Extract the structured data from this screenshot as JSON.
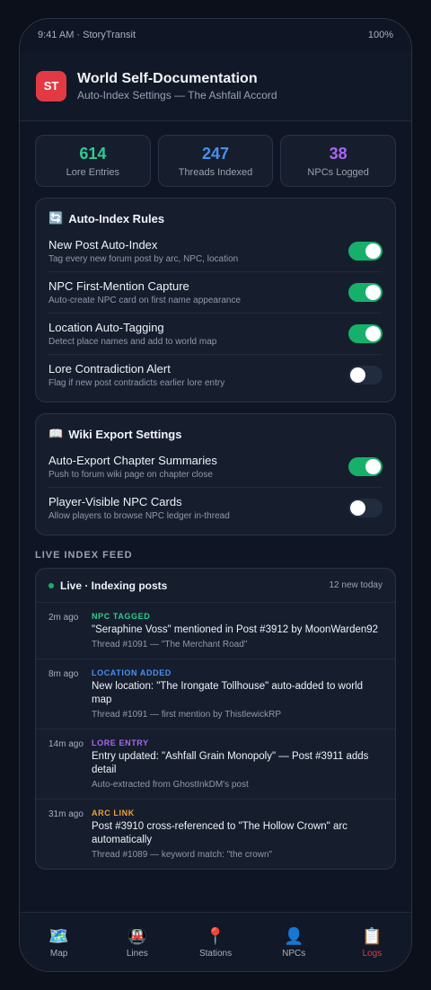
{
  "status_bar": {
    "left": "9:41 AM · StoryTransit",
    "right": "100%"
  },
  "header": {
    "logo": "ST",
    "title": "World Self-Documentation",
    "subtitle": "Auto-Index Settings — The Ashfall Accord"
  },
  "stats": [
    {
      "value": "614",
      "label": "Lore Entries",
      "color": "#2ecc8f"
    },
    {
      "value": "247",
      "label": "Threads Indexed",
      "color": "#4a8ff0"
    },
    {
      "value": "38",
      "label": "NPCs Logged",
      "color": "#a866f0"
    }
  ],
  "auto_index": {
    "icon": "🔄",
    "title": "Auto-Index Rules",
    "rows": [
      {
        "title": "New Post Auto-Index",
        "desc": "Tag every new forum post by arc, NPC, location",
        "on": true
      },
      {
        "title": "NPC First-Mention Capture",
        "desc": "Auto-create NPC card on first name appearance",
        "on": true
      },
      {
        "title": "Location Auto-Tagging",
        "desc": "Detect place names and add to world map",
        "on": true
      },
      {
        "title": "Lore Contradiction Alert",
        "desc": "Flag if new post contradicts earlier lore entry",
        "on": false
      }
    ]
  },
  "wiki_export": {
    "icon": "📖",
    "title": "Wiki Export Settings",
    "rows": [
      {
        "title": "Auto-Export Chapter Summaries",
        "desc": "Push to forum wiki page on chapter close",
        "on": true
      },
      {
        "title": "Player-Visible NPC Cards",
        "desc": "Allow players to browse NPC ledger in-thread",
        "on": false
      }
    ]
  },
  "feed": {
    "section_label": "LIVE INDEX FEED",
    "live_label": "Live · Indexing posts",
    "count": "12 new today",
    "entries": [
      {
        "time": "2m ago",
        "tag": "NPC TAGGED",
        "tag_color": "#2ecc8f",
        "message": "\"Seraphine Voss\" mentioned in Post #3912 by MoonWarden92",
        "meta": "Thread #1091 — \"The Merchant Road\""
      },
      {
        "time": "8m ago",
        "tag": "LOCATION ADDED",
        "tag_color": "#4a8ff0",
        "message": "New location: \"The Irongate Tollhouse\" auto-added to world map",
        "meta": "Thread #1091 — first mention by ThistlewickRP"
      },
      {
        "time": "14m ago",
        "tag": "LORE ENTRY",
        "tag_color": "#a866f0",
        "message": "Entry updated: \"Ashfall Grain Monopoly\" — Post #3911 adds detail",
        "meta": "Auto-extracted from GhostInkDM's post"
      },
      {
        "time": "31m ago",
        "tag": "ARC LINK",
        "tag_color": "#f0a030",
        "message": "Post #3910 cross-referenced to \"The Hollow Crown\" arc automatically",
        "meta": "Thread #1089 — keyword match: \"the crown\""
      }
    ]
  },
  "tabs": [
    {
      "icon": "🗺️",
      "icon_name": "map-icon",
      "label": "Map",
      "active": false
    },
    {
      "icon": "🚇",
      "icon_name": "lines-icon",
      "label": "Lines",
      "active": false
    },
    {
      "icon": "📍",
      "icon_name": "stations-icon",
      "label": "Stations",
      "active": false
    },
    {
      "icon": "👤",
      "icon_name": "npcs-icon",
      "label": "NPCs",
      "active": false
    },
    {
      "icon": "📋",
      "icon_name": "logs-icon",
      "label": "Logs",
      "active": true
    }
  ]
}
